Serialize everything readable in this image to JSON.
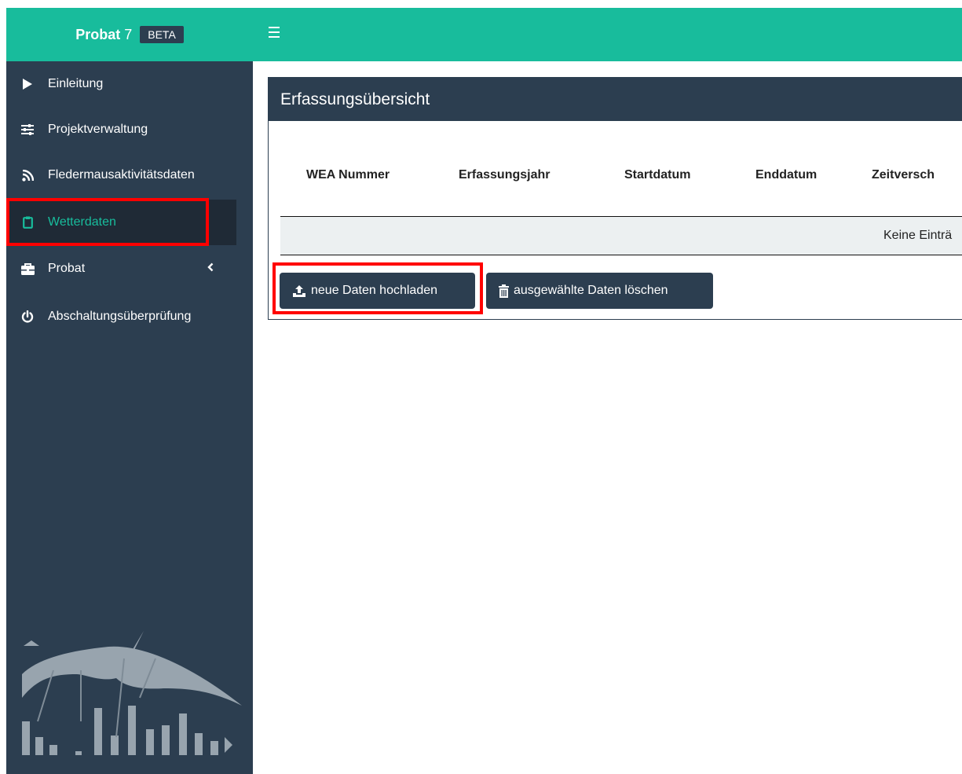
{
  "app": {
    "brand_bold": "Probat",
    "brand_version": "7",
    "brand_badge": "BETA"
  },
  "sidebar": {
    "items": [
      {
        "label": "Einleitung",
        "icon": "play-icon"
      },
      {
        "label": "Projektverwaltung",
        "icon": "sliders-icon"
      },
      {
        "label": "Fledermausaktivitätsdaten",
        "icon": "rss-icon"
      },
      {
        "label": "Wetterdaten",
        "icon": "clipboard-icon",
        "active": true
      },
      {
        "label": "Probat",
        "icon": "toolbox-icon",
        "expandable": true
      },
      {
        "label": "Abschaltungsüberprüfung",
        "icon": "power-icon"
      }
    ]
  },
  "panel": {
    "title": "Erfassungsübersicht",
    "columns": [
      "WEA Nummer",
      "Erfassungsjahr",
      "Startdatum",
      "Enddatum",
      "Zeitversch"
    ],
    "empty_text": "Keine Einträ",
    "upload_label": "neue Daten hochladen",
    "delete_label": "ausgewählte Daten löschen"
  },
  "colors": {
    "topbar": "#18bc9c",
    "sidebar": "#2c3e50",
    "active_text": "#18bc9c",
    "highlight": "#ff0000"
  }
}
